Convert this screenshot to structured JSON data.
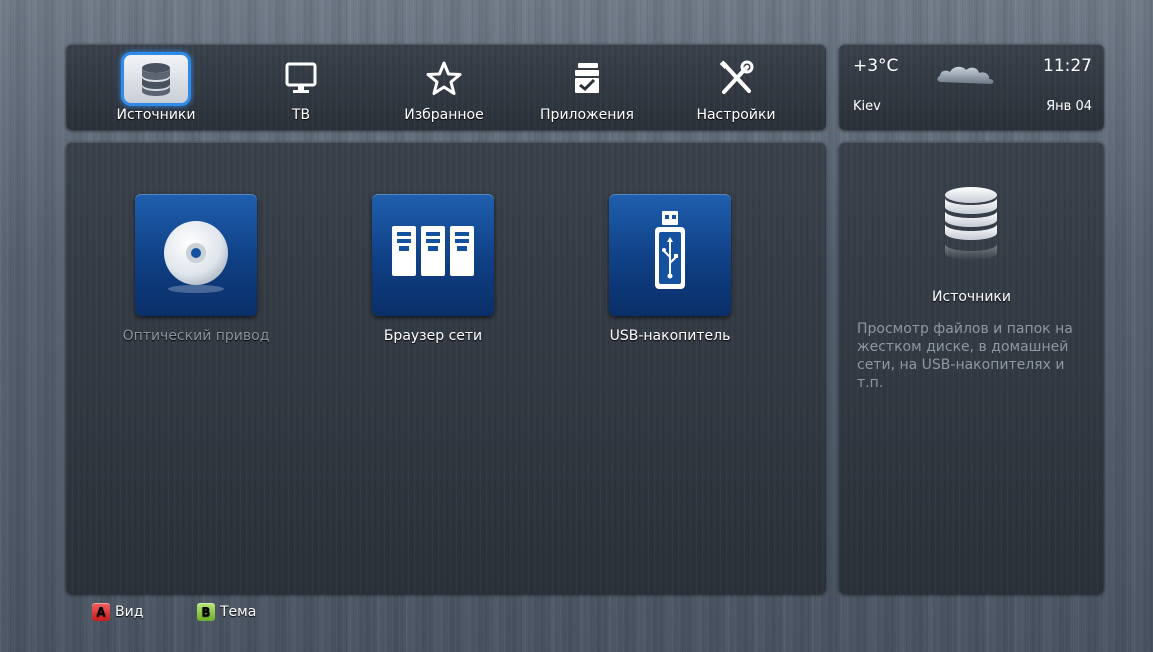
{
  "nav": {
    "items": [
      {
        "label": "Источники",
        "icon": "database-icon",
        "active": true
      },
      {
        "label": "ТВ",
        "icon": "tv-icon",
        "active": false
      },
      {
        "label": "Избранное",
        "icon": "star-icon",
        "active": false
      },
      {
        "label": "Приложения",
        "icon": "apps-icon",
        "active": false
      },
      {
        "label": "Настройки",
        "icon": "tools-icon",
        "active": false
      }
    ]
  },
  "weather": {
    "temperature": "+3°C",
    "time": "11:27",
    "city": "Kiev",
    "date": "Янв 04",
    "icon": "cloud-icon"
  },
  "sources": [
    {
      "label": "Оптический привод",
      "icon": "disc-icon",
      "enabled": false
    },
    {
      "label": "Браузер сети",
      "icon": "network-servers-icon",
      "enabled": true
    },
    {
      "label": "USB-накопитель",
      "icon": "usb-drive-icon",
      "enabled": true
    }
  ],
  "info": {
    "title": "Источники",
    "description": "Просмотр файлов и папок на жестком диске, в домашней сети, на USB-накопителях и т.п.",
    "icon": "database-icon"
  },
  "legend": [
    {
      "key": "A",
      "label": "Вид",
      "color": "#d92a2a"
    },
    {
      "key": "B",
      "label": "Тема",
      "color": "#86c23a"
    }
  ],
  "colors": {
    "accent": "#2f8be8",
    "tile": "#1452a0"
  }
}
